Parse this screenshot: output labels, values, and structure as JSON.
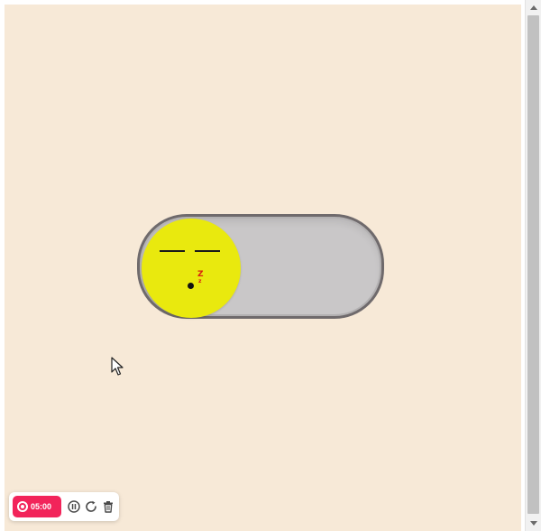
{
  "toggle": {
    "state": "off",
    "face_color": "#e9e90e",
    "track_color": "#c9c7c8",
    "track_border_color": "#6f6a6c",
    "sleep_text_large": "Z",
    "sleep_text_small": "z",
    "sleep_text_color": "#d9230f"
  },
  "page": {
    "background": "#f7e9d7"
  },
  "recorder": {
    "timer": "05:00",
    "accent": "#f2245a",
    "icons": [
      "record-icon",
      "pause-icon",
      "restart-icon",
      "delete-icon"
    ]
  }
}
